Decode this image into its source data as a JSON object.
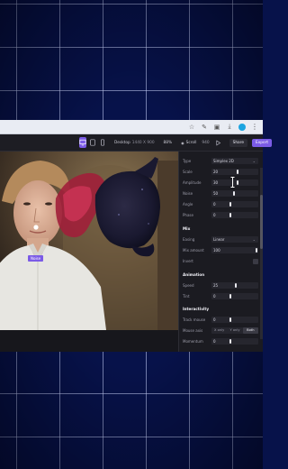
{
  "browser": {
    "icons": [
      "star-icon",
      "extension-icon",
      "puzzle-icon",
      "download-icon",
      "profile-avatar",
      "more-icon"
    ]
  },
  "toolbar": {
    "device_label": "Desktop",
    "device_size": "1440 X 900",
    "zoom": "88%",
    "scroll_label": "Scroll",
    "scroll_value": "940",
    "share_label": "Share",
    "export_label": "Export"
  },
  "canvas": {
    "layer_tag": "Noise"
  },
  "panel": {
    "rows": [
      {
        "label": "Type",
        "value": "Simplex 2D",
        "kind": "select"
      },
      {
        "label": "Scale",
        "value": "20",
        "kind": "slider",
        "level": 0.55
      },
      {
        "label": "Amplitude",
        "value": "30",
        "kind": "slider",
        "level": 0.55
      },
      {
        "label": "Noise",
        "value": "50",
        "kind": "slider",
        "level": 0.45
      },
      {
        "label": "Angle",
        "value": "0",
        "kind": "slider",
        "level": 0.0
      },
      {
        "label": "Phase",
        "value": "0",
        "kind": "slider",
        "level": 0.0
      }
    ],
    "mix": {
      "title": "Mix",
      "rows": [
        {
          "label": "Easing",
          "value": "Linear",
          "kind": "select"
        },
        {
          "label": "Mix amount",
          "value": "100",
          "kind": "slider",
          "level": 1.0
        },
        {
          "label": "Invert",
          "value": "",
          "kind": "checkbox"
        }
      ]
    },
    "animation": {
      "title": "Animation",
      "rows": [
        {
          "label": "Speed",
          "value": "25",
          "kind": "slider",
          "level": 0.5
        },
        {
          "label": "Tint",
          "value": "0",
          "kind": "slider",
          "level": 0.0
        }
      ]
    },
    "interactivity": {
      "title": "Interactivity",
      "rows": [
        {
          "label": "Track mouse",
          "value": "0",
          "kind": "slider",
          "level": 0.0
        },
        {
          "label": "Mouse axis",
          "kind": "segmented",
          "options": [
            "X only",
            "Y only",
            "Both"
          ],
          "selected": "Both"
        },
        {
          "label": "Momentum",
          "value": "0",
          "kind": "slider",
          "level": 0.0
        }
      ]
    }
  }
}
